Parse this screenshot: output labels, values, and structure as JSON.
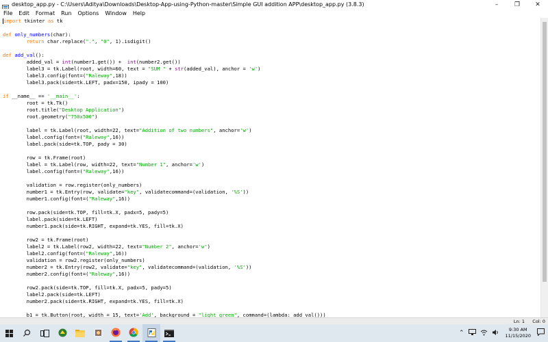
{
  "window": {
    "title": "desktop_app.py - C:\\Users\\Aditya\\Downloads\\Desktop-App-using-Python-master\\Simple GUI addition APP\\desktop_app.py (3.8.3)",
    "controls": [
      "minimize-icon",
      "maximize-icon",
      "close-icon"
    ]
  },
  "menu": {
    "items": [
      "File",
      "Edit",
      "Format",
      "Run",
      "Options",
      "Window",
      "Help"
    ]
  },
  "status": {
    "line": "Ln: 1",
    "col": "Col: 0"
  },
  "taskbar": {
    "apps": [
      "start-icon",
      "search-icon",
      "task-view-icon",
      "windows-logo-icon",
      "file-explorer-icon",
      "app-icon",
      "firefox-icon",
      "chrome-icon",
      "python-idle-icon",
      "terminal-icon"
    ]
  },
  "tray": {
    "icons": [
      "chevron-up-icon",
      "network-icon",
      "volume-icon",
      "wifi-icon"
    ],
    "time": "9:30 AM",
    "date": "11/15/2020",
    "notification_icon": "notification-icon"
  },
  "code_lines": [
    "import tkinter as tk",
    "",
    "def only_numbers(char):",
    "        return char.replace(\".\", \"0\", 1).isdigit()",
    "",
    "def add_val():",
    "        added_val = int(number1.get()) +  int(number2.get())",
    "        label3 = tk.Label(root, width=60, text = \"SUM \" + str(added_val), anchor = 'w')",
    "        label3.config(font=(\"Raleway\",18))",
    "        label3.pack(side=tk.LEFT, padx=150, ipady = 100)",
    "",
    "if __name__ == '__main__':",
    "        root = tk.Tk()",
    "        root.title(\"Desktop Application\")",
    "        root.geometry(\"750x500\")",
    "",
    "        label = tk.Label(root, width=22, text=\"Addition of two numbers\", anchor='w')",
    "        label.config(font=(\"Raleway\",16))",
    "        label.pack(side=tk.TOP, pady = 30)",
    "",
    "        row = tk.Frame(root)",
    "        label = tk.Label(row, width=22, text=\"Number 1\", anchor='w')",
    "        label.config(font=(\"Raleway\",16))",
    "",
    "        validation = row.register(only_numbers)",
    "        number1 = tk.Entry(row, validate=\"key\", validatecommand=(validation, '%S'))",
    "        number1.config(font=(\"Raleway\",16))",
    "",
    "        row.pack(side=tk.TOP, fill=tk.X, padx=5, pady=5)",
    "        label.pack(side=tk.LEFT)",
    "        number1.pack(side=tk.RIGHT, expand=tk.YES, fill=tk.X)",
    "",
    "        row2 = tk.Frame(root)",
    "        label2 = tk.Label(row2, width=22, text=\"Number 2\", anchor='w')",
    "        label2.config(font=(\"Raleway\",16))",
    "        validation = row2.register(only_numbers)",
    "        number2 = tk.Entry(row2, validate=\"key\", validatecommand=(validation, '%S'))",
    "        number2.config(font=(\"Raleway\",16))",
    "",
    "        row2.pack(side=tk.TOP, fill=tk.X, padx=5, pady=5)",
    "        label2.pack(side=tk.LEFT)",
    "        number2.pack(side=tk.RIGHT, expand=tk.YES, fill=tk.X)",
    "",
    "        b1 = tk.Button(root, width = 15, text='Add', background = \"light green\", command=(lambda: add_val()))"
  ]
}
